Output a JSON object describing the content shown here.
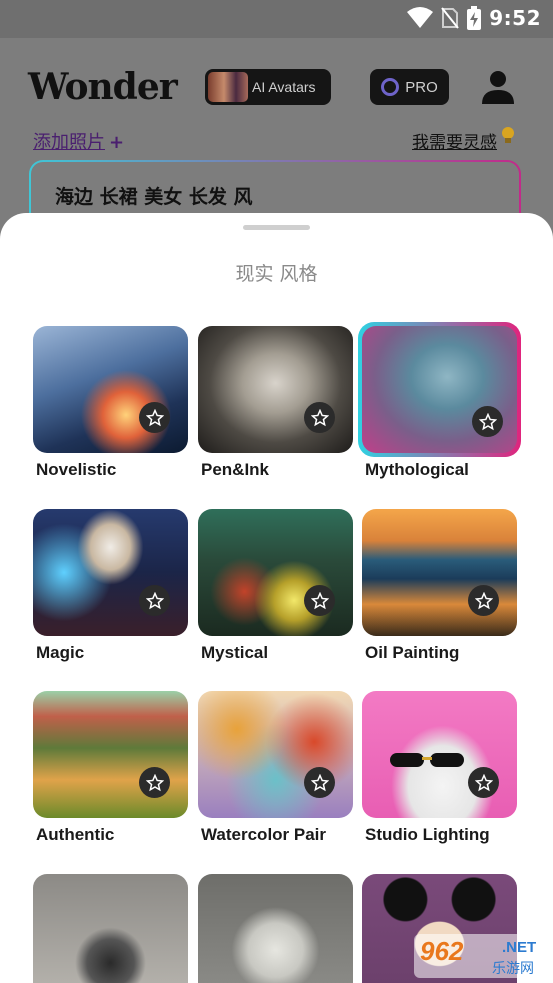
{
  "status_bar": {
    "time": "9:52",
    "icons": [
      "wifi-icon",
      "no-sim-icon",
      "battery-charging-icon"
    ]
  },
  "header": {
    "logo": "Wonder",
    "ai_avatars_label": "AI Avatars",
    "pro_label": "PRO",
    "profile_icon": "person-icon"
  },
  "links": {
    "add_photo": "添加照片",
    "add_photo_plus": "+",
    "inspiration": "我需要灵感"
  },
  "prompt": {
    "value": "海边 长裙 美女 长发 风"
  },
  "sheet": {
    "title": "现实 风格",
    "styles": [
      {
        "label": "Novelistic",
        "selected": false
      },
      {
        "label": "Pen&Ink",
        "selected": false
      },
      {
        "label": "Mythological",
        "selected": true
      },
      {
        "label": "Magic",
        "selected": false
      },
      {
        "label": "Mystical",
        "selected": false
      },
      {
        "label": "Oil Painting",
        "selected": false
      },
      {
        "label": "Authentic",
        "selected": false
      },
      {
        "label": "Watercolor Pair",
        "selected": false
      },
      {
        "label": "Studio Lighting",
        "selected": false
      },
      {
        "label": "",
        "selected": false
      },
      {
        "label": "",
        "selected": false
      },
      {
        "label": "",
        "selected": false
      }
    ]
  },
  "watermark": {
    "brand": "962",
    "net": ".NET",
    "sub": "乐游网"
  },
  "colors": {
    "accent_gradient_start": "#2fd2e2",
    "accent_gradient_end": "#e0247d",
    "add_photo_link": "#4a1f6f"
  }
}
